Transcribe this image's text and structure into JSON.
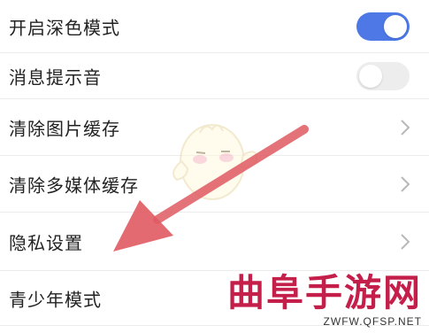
{
  "settings": {
    "dark_mode_label": "开启深色模式",
    "dark_mode_on": true,
    "notification_sound_label": "消息提示音",
    "notification_sound_on": false,
    "clear_image_cache_label": "清除图片缓存",
    "clear_media_cache_label": "清除多媒体缓存",
    "privacy_settings_label": "隐私设置",
    "youth_mode_label": "青少年模式"
  },
  "colors": {
    "toggle_on": "#4d78e6",
    "toggle_off": "#ededed",
    "arrow": "#e05a62",
    "watermark": "#c41f4a"
  },
  "watermark": {
    "title": "曲阜手游网",
    "url": "ZWFW.QFSP.NET"
  }
}
